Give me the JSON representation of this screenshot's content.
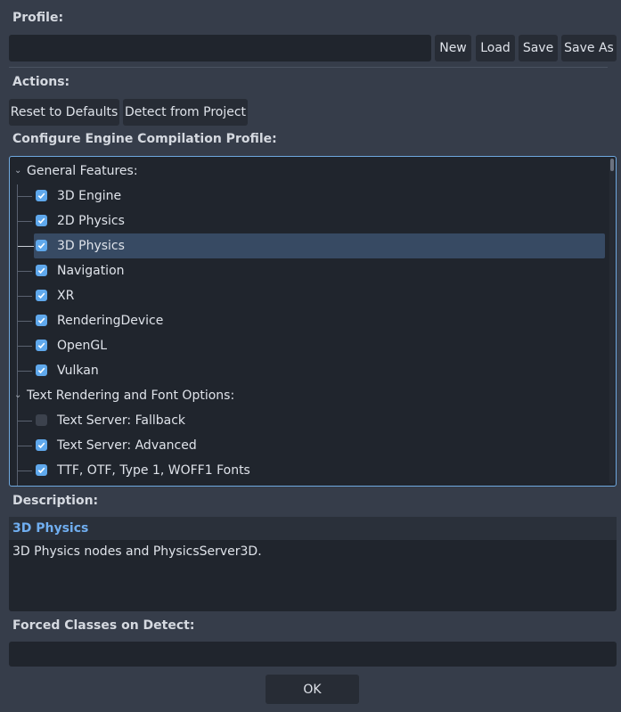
{
  "profile": {
    "label": "Profile:",
    "value": "",
    "buttons": {
      "new": "New",
      "load": "Load",
      "save": "Save",
      "save_as": "Save As"
    }
  },
  "actions": {
    "label": "Actions:",
    "reset": "Reset to Defaults",
    "detect": "Detect from Project"
  },
  "configure": {
    "label": "Configure Engine Compilation Profile:",
    "groups": [
      {
        "title": "General Features:",
        "items": [
          {
            "label": "3D Engine",
            "checked": true
          },
          {
            "label": "2D Physics",
            "checked": true
          },
          {
            "label": "3D Physics",
            "checked": true,
            "selected": true
          },
          {
            "label": "Navigation",
            "checked": true
          },
          {
            "label": "XR",
            "checked": true
          },
          {
            "label": "RenderingDevice",
            "checked": true
          },
          {
            "label": "OpenGL",
            "checked": true
          },
          {
            "label": "Vulkan",
            "checked": true
          }
        ]
      },
      {
        "title": "Text Rendering and Font Options:",
        "items": [
          {
            "label": "Text Server: Fallback",
            "checked": false
          },
          {
            "label": "Text Server: Advanced",
            "checked": true
          },
          {
            "label": "TTF, OTF, Type 1, WOFF1 Fonts",
            "checked": true
          }
        ]
      }
    ]
  },
  "description": {
    "label": "Description:",
    "title": "3D Physics",
    "text": "3D Physics nodes and PhysicsServer3D."
  },
  "forced": {
    "label": "Forced Classes on Detect:",
    "value": ""
  },
  "ok": "OK",
  "colors": {
    "accent": "#6fa9e0",
    "checkbox": "#5fa8ec",
    "selected_row": "#374a63"
  }
}
